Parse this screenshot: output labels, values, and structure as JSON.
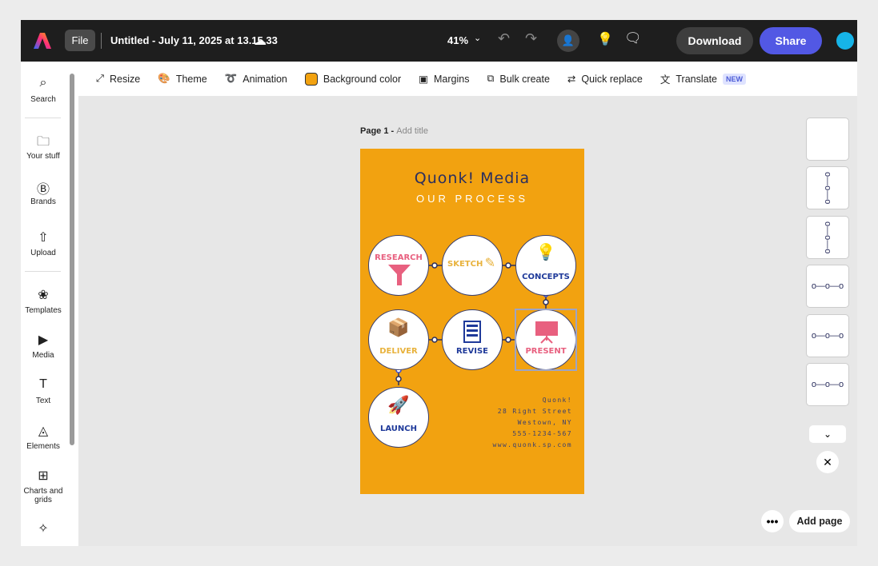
{
  "topbar": {
    "file": "File",
    "title": "Untitled - July 11, 2025 at 13.15.33",
    "zoom": "41%",
    "download": "Download",
    "share": "Share"
  },
  "toolbar": {
    "items": [
      {
        "label": "Resize"
      },
      {
        "label": "Theme"
      },
      {
        "label": "Animation"
      },
      {
        "label": "Background color"
      },
      {
        "label": "Margins"
      },
      {
        "label": "Bulk create"
      },
      {
        "label": "Quick replace"
      },
      {
        "label": "Translate"
      }
    ],
    "new_badge": "NEW"
  },
  "sidebar": {
    "items": [
      {
        "label": "Search"
      },
      {
        "label": "Your stuff"
      },
      {
        "label": "Brands"
      },
      {
        "label": "Upload"
      },
      {
        "label": "Templates"
      },
      {
        "label": "Media"
      },
      {
        "label": "Text"
      },
      {
        "label": "Elements"
      },
      {
        "label": "Charts and grids"
      }
    ]
  },
  "page": {
    "label": "Page 1 - ",
    "add_title": "Add title"
  },
  "poster": {
    "title": "Quonk! Media",
    "subtitle": "OUR PROCESS",
    "steps": [
      "RESEARCH",
      "SKETCH",
      "CONCEPTS",
      "DELIVER",
      "REVISE",
      "PRESENT",
      "LAUNCH"
    ],
    "address": [
      "Quonk!",
      "28 Right Street",
      "Westown, NY",
      "555-1234-567",
      "www.quonk.sp.com"
    ],
    "bg_color": "#f2a210"
  },
  "footer": {
    "add_page": "Add page"
  }
}
